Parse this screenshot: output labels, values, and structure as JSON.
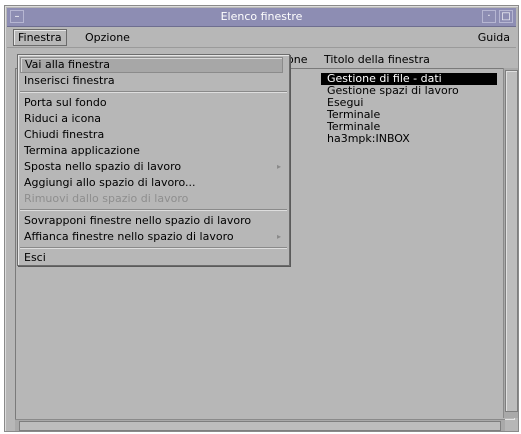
{
  "window": {
    "title": "Elenco finestre"
  },
  "menubar": {
    "items": [
      "Finestra",
      "Opzione"
    ],
    "help": "Guida"
  },
  "columns": {
    "partial": "one",
    "title": "Titolo della finestra"
  },
  "window_list": {
    "items": [
      "Gestione di file - dati",
      "Gestione spazi di lavoro",
      "Esegui",
      "Terminale",
      "Terminale",
      "ha3mpk:INBOX"
    ],
    "selected_index": 0
  },
  "finestra_menu": {
    "items": [
      "Vai alla finestra",
      "Inserisci finestra",
      "Porta sul fondo",
      "Riduci a icona",
      "Chiudi finestra",
      "Termina applicazione",
      "Sposta nello spazio di lavoro",
      "Aggiungi allo spazio di lavoro...",
      "Rimuovi dallo spazio di lavoro",
      "Sovrapponi finestre nello spazio di lavoro",
      "Affianca finestre nello spazio di lavoro",
      "Esci"
    ],
    "highlighted_index": 0,
    "disabled_indices": [
      8
    ],
    "cascade_indices": [
      6,
      10
    ]
  },
  "colors": {
    "titlebar": "#8d8db3",
    "window_bg": "#b7b7b7",
    "selection_bg": "#000000"
  }
}
